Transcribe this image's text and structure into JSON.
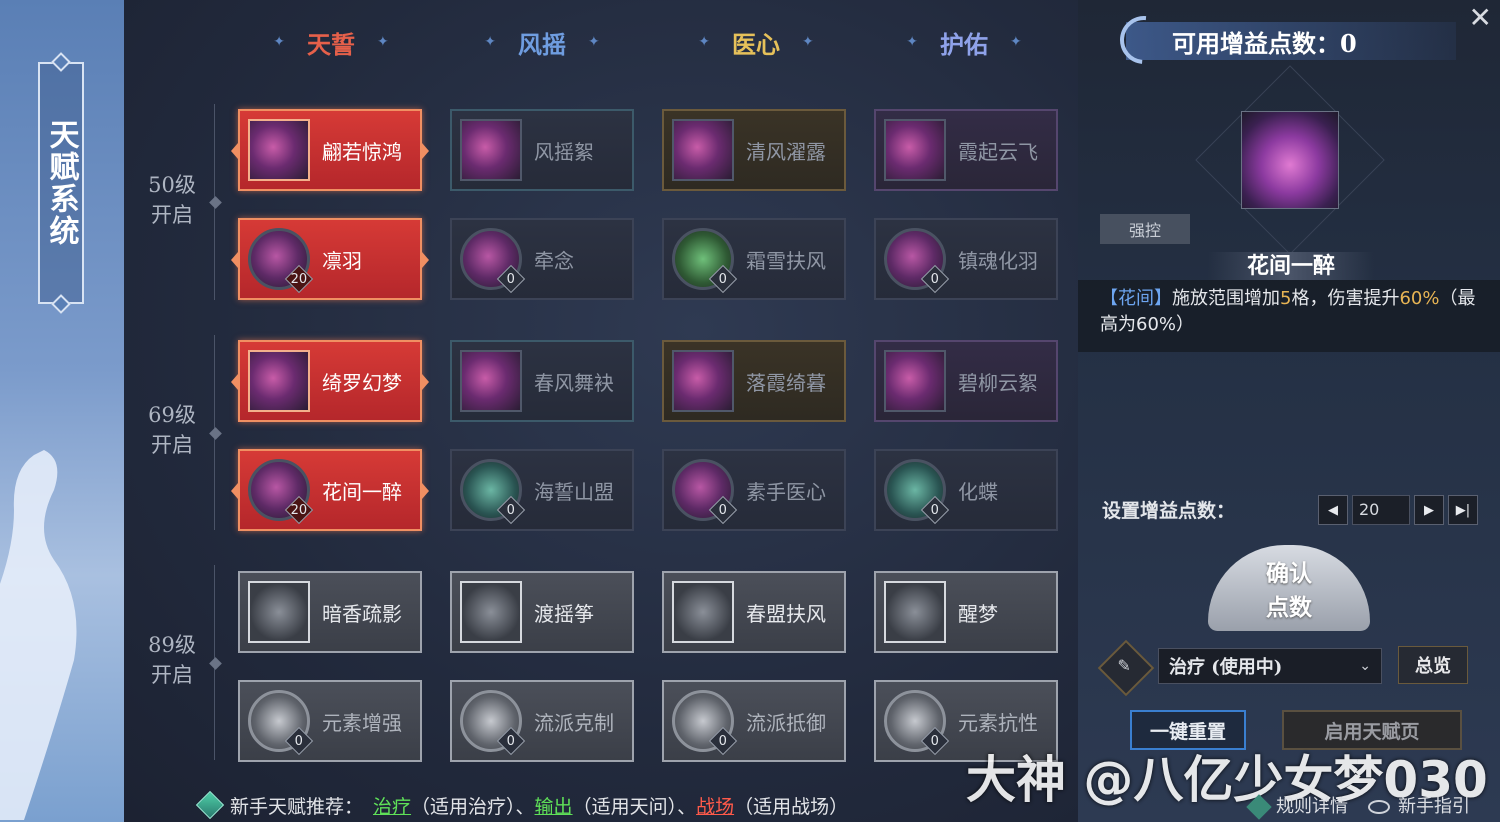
{
  "window": {
    "title": "天赋系统"
  },
  "columns": [
    {
      "label": "天誓",
      "color": "#e6604a"
    },
    {
      "label": "风摇",
      "color": "#6f9de0"
    },
    {
      "label": "医心",
      "color": "#e6c15a"
    },
    {
      "label": "护佑",
      "color": "#8fa2ea"
    }
  ],
  "levels": [
    {
      "level": "50级",
      "text": "开启"
    },
    {
      "level": "69级",
      "text": "开启"
    },
    {
      "level": "89级",
      "text": "开启"
    }
  ],
  "rows": [
    [
      {
        "name": "翩若惊鸿",
        "count": "",
        "icon": "swirl-icon",
        "state": "active"
      },
      {
        "name": "风摇絮",
        "count": "",
        "icon": "swirl-icon",
        "state": "teal"
      },
      {
        "name": "清风濯露",
        "count": "",
        "icon": "leaf-icon",
        "state": "gold"
      },
      {
        "name": "霞起云飞",
        "count": "",
        "icon": "dancer-icon",
        "state": "purp"
      }
    ],
    [
      {
        "name": "凛羽",
        "count": "20",
        "icon": "feather-orb-icon",
        "state": "active"
      },
      {
        "name": "牵念",
        "count": "0",
        "icon": "ribbon-orb-icon",
        "state": "dark"
      },
      {
        "name": "霜雪扶风",
        "count": "0",
        "icon": "dancer-orb-icon",
        "state": "dark"
      },
      {
        "name": "镇魂化羽",
        "count": "0",
        "icon": "spirit-orb-icon",
        "state": "dark"
      }
    ],
    [
      {
        "name": "绮罗幻梦",
        "count": "",
        "icon": "petal-icon",
        "state": "active"
      },
      {
        "name": "春风舞袂",
        "count": "",
        "icon": "swirl-icon",
        "state": "teal"
      },
      {
        "name": "落霞绮暮",
        "count": "",
        "icon": "dancer-icon",
        "state": "gold"
      },
      {
        "name": "碧柳云絮",
        "count": "",
        "icon": "blossom-icon",
        "state": "purp"
      }
    ],
    [
      {
        "name": "花间一醉",
        "count": "20",
        "icon": "dancer-orb-icon",
        "state": "active"
      },
      {
        "name": "海誓山盟",
        "count": "0",
        "icon": "figure-orb-icon",
        "state": "dark"
      },
      {
        "name": "素手医心",
        "count": "0",
        "icon": "dancer-orb-icon",
        "state": "dark"
      },
      {
        "name": "化蝶",
        "count": "0",
        "icon": "butterfly-orb-icon",
        "state": "dark"
      }
    ],
    [
      {
        "name": "暗香疏影",
        "count": "",
        "icon": "dash-icon",
        "state": "grey"
      },
      {
        "name": "渡摇筝",
        "count": "",
        "icon": "lotus-icon",
        "state": "grey"
      },
      {
        "name": "春盟扶风",
        "count": "",
        "icon": "fan-icon",
        "state": "grey"
      },
      {
        "name": "醒梦",
        "count": "",
        "icon": "fairy-icon",
        "state": "grey"
      }
    ],
    [
      {
        "name": "元素增强",
        "count": "0",
        "icon": "element-orb-icon",
        "state": "grey"
      },
      {
        "name": "流派克制",
        "count": "0",
        "icon": "element-orb-icon",
        "state": "grey"
      },
      {
        "name": "流派抵御",
        "count": "0",
        "icon": "element-orb-icon",
        "state": "grey"
      },
      {
        "name": "元素抗性",
        "count": "0",
        "icon": "element-orb-icon",
        "state": "grey"
      }
    ]
  ],
  "panel": {
    "points_label": "可用增益点数：0",
    "tag": "强控",
    "skill_name": "花间一醉",
    "desc_tag": "【花间】",
    "desc_1": "施放范围增加",
    "desc_num1": "5",
    "desc_2": "格，伤害提升",
    "desc_num2": "60%",
    "desc_3": "（最高为60%）",
    "set_label": "设置增益点数：",
    "step_value": "20",
    "confirm_1": "确认",
    "confirm_2": "点数",
    "plan": "治疗 (使用中)",
    "overview": "总览",
    "reset": "一键重置",
    "enable": "启用天赋页"
  },
  "footer": {
    "prefix": "新手天赋推荐：",
    "l1": "治疗",
    "s1": "（适用治疗）、",
    "l2": "输出",
    "s2": "（适用天问）、",
    "l3": "战场",
    "s3": "（适用战场）",
    "watermark": "大神 @八亿少女梦030",
    "rules": "规则详情",
    "guide": "新手指引"
  },
  "colors": {
    "active": "#c8302f",
    "accent_blue": "#6da5f0",
    "num_gold": "#e7b454"
  }
}
